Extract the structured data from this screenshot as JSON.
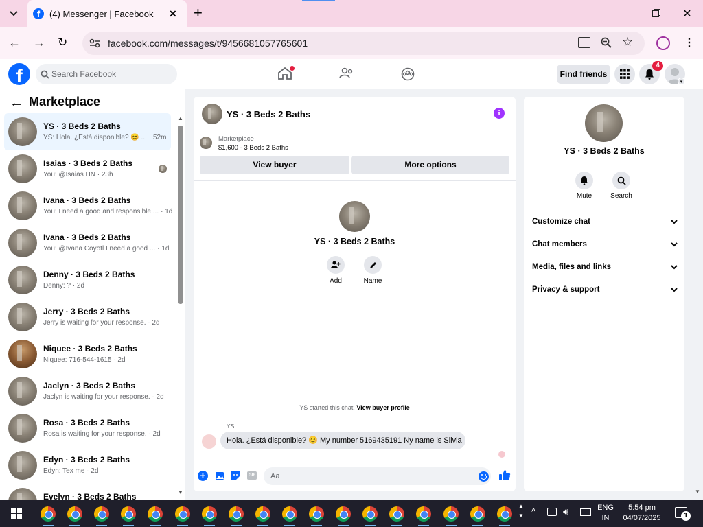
{
  "browser": {
    "tab_title": "(4) Messenger | Facebook",
    "url": "facebook.com/messages/t/9456681057765601"
  },
  "fb": {
    "search_placeholder": "Search Facebook",
    "find_friends": "Find friends",
    "notif_count": "4"
  },
  "left": {
    "title": "Marketplace",
    "conversations": [
      {
        "name": "YS · 3 Beds 2 Baths",
        "preview": "YS: Hola. ¿Está disponible? 😊 ...",
        "time": "· 52m",
        "selected": true
      },
      {
        "name": "Isaias · 3 Beds 2 Baths",
        "preview": "You: @Isaias HN · 23h",
        "time": ""
      },
      {
        "name": "Ivana · 3 Beds 2 Baths",
        "preview": "You: I need a good and responsible ...",
        "time": "· 1d"
      },
      {
        "name": "Ivana · 3 Beds 2 Baths",
        "preview": "You: @Ivana Coyotl I need a good ...",
        "time": "· 1d"
      },
      {
        "name": "Denny · 3 Beds 2 Baths",
        "preview": "Denny: ? · 2d",
        "time": ""
      },
      {
        "name": "Jerry · 3 Beds 2 Baths",
        "preview": "Jerry is waiting for your response. · 2d",
        "time": ""
      },
      {
        "name": "Niquee · 3 Beds 2 Baths",
        "preview": "Niquee: 716-544-1615 · 2d",
        "time": ""
      },
      {
        "name": "Jaclyn · 3 Beds 2 Baths",
        "preview": "Jaclyn is waiting for your response. · 2d",
        "time": ""
      },
      {
        "name": "Rosa · 3 Beds 2 Baths",
        "preview": "Rosa is waiting for your response. · 2d",
        "time": ""
      },
      {
        "name": "Edyn · 3 Beds 2 Baths",
        "preview": "Edyn: Tex me · 2d",
        "time": ""
      },
      {
        "name": "Evelyn · 3 Beds 2 Baths",
        "preview": "",
        "time": ""
      }
    ]
  },
  "chat": {
    "title": "YS · 3 Beds 2 Baths",
    "market_label": "Marketplace",
    "listing": "$1,600 - 3 Beds 2 Baths",
    "view_buyer": "View buyer",
    "more_options": "More options",
    "profile_name": "YS · 3 Beds 2 Baths",
    "add_label": "Add",
    "name_label": "Name",
    "started_text": "YS started this chat.",
    "view_profile": "View buyer profile",
    "sender": "YS",
    "message": "Hola. ¿Está disponible? 😊 My number 5169435191 Ny name is Silvia",
    "composer_placeholder": "Aa"
  },
  "right": {
    "name": "YS · 3 Beds 2 Baths",
    "mute": "Mute",
    "search": "Search",
    "sections": [
      "Customize chat",
      "Chat members",
      "Media, files and links",
      "Privacy & support"
    ]
  },
  "taskbar": {
    "lang1": "ENG",
    "lang2": "IN",
    "time": "5:54 pm",
    "date": "04/07/2025",
    "notif": "1"
  },
  "colors": {
    "fb_blue": "#0866ff",
    "selected_bg": "#ebf5ff",
    "chrome_tab": "#f7d6e6",
    "info_purple": "#a033ff"
  }
}
